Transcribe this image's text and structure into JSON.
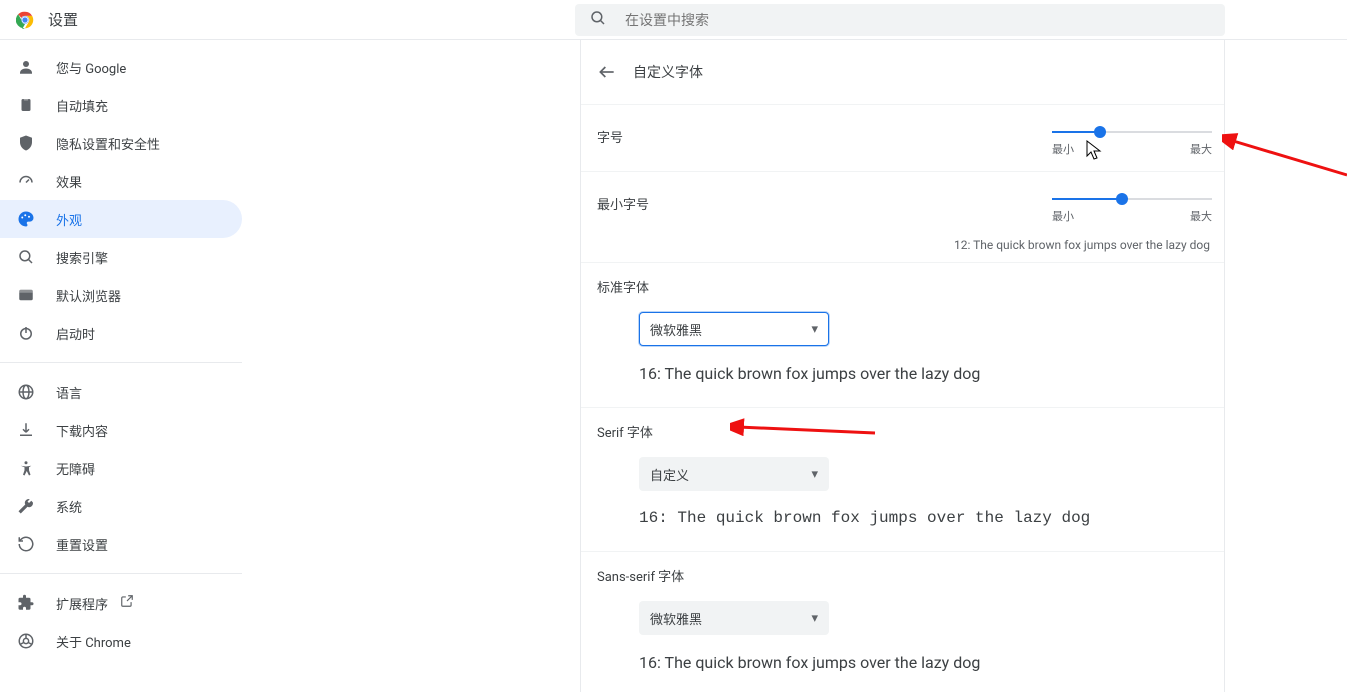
{
  "header": {
    "title": "设置",
    "search_placeholder": "在设置中搜索"
  },
  "sidebar": {
    "items": [
      {
        "id": "you-and-google",
        "label": "您与 Google"
      },
      {
        "id": "autofill",
        "label": "自动填充"
      },
      {
        "id": "privacy",
        "label": "隐私设置和安全性"
      },
      {
        "id": "performance",
        "label": "效果"
      },
      {
        "id": "appearance",
        "label": "外观"
      },
      {
        "id": "search-engine",
        "label": "搜索引擎"
      },
      {
        "id": "default-browser",
        "label": "默认浏览器"
      },
      {
        "id": "on-startup",
        "label": "启动时"
      }
    ],
    "items2": [
      {
        "id": "languages",
        "label": "语言"
      },
      {
        "id": "downloads",
        "label": "下载内容"
      },
      {
        "id": "accessibility",
        "label": "无障碍"
      },
      {
        "id": "system",
        "label": "系统"
      },
      {
        "id": "reset",
        "label": "重置设置"
      }
    ],
    "items3": [
      {
        "id": "extensions",
        "label": "扩展程序"
      },
      {
        "id": "about",
        "label": "关于 Chrome"
      }
    ]
  },
  "page": {
    "title": "自定义字体",
    "font_size": {
      "label": "字号",
      "min_label": "最小",
      "max_label": "最大",
      "percent": 30
    },
    "min_font_size": {
      "label": "最小字号",
      "min_label": "最小",
      "max_label": "最大",
      "percent": 44,
      "preview": "12: The quick brown fox jumps over the lazy dog"
    },
    "standard_font": {
      "label": "标准字体",
      "value": "微软雅黑",
      "sample": "16: The quick brown fox jumps over the lazy dog"
    },
    "serif_font": {
      "label": "Serif 字体",
      "value": "自定义",
      "sample": "16: The quick brown fox jumps over the lazy dog"
    },
    "sans_font": {
      "label": "Sans-serif 字体",
      "value": "微软雅黑",
      "sample": "16: The quick brown fox jumps over the lazy dog"
    }
  }
}
